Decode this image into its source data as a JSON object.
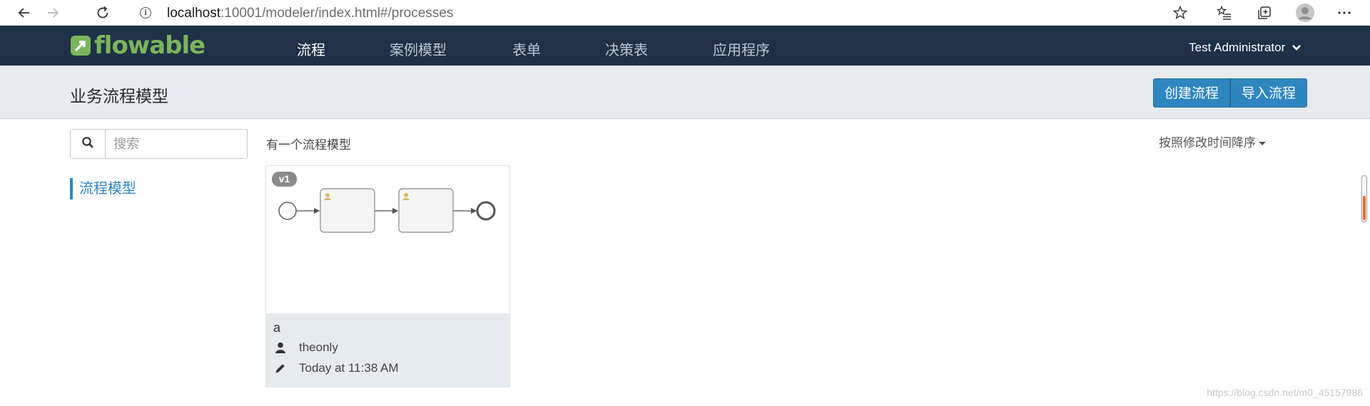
{
  "browser": {
    "url_host": "localhost",
    "url_rest": ":10001/modeler/index.html#/processes",
    "icons": [
      "back-arrow-icon",
      "forward-arrow-icon",
      "refresh-icon",
      "info-icon",
      "favorite-star-icon",
      "favorites-list-icon",
      "collections-icon",
      "profile-icon",
      "more-icon"
    ]
  },
  "navbar": {
    "brand": "flowable",
    "items": [
      {
        "label": "流程",
        "active": true
      },
      {
        "label": "案例模型",
        "active": false
      },
      {
        "label": "表单",
        "active": false
      },
      {
        "label": "决策表",
        "active": false
      },
      {
        "label": "应用程序",
        "active": false
      }
    ],
    "user": "Test Administrator"
  },
  "subheader": {
    "title": "业务流程模型",
    "create_label": "创建流程",
    "import_label": "导入流程"
  },
  "sidebar": {
    "search_placeholder": "搜索",
    "link_label": "流程模型"
  },
  "main": {
    "count_text": "有一个流程模型",
    "sort_label": "按照修改时间降序"
  },
  "card": {
    "version": "v1",
    "name": "a",
    "owner": "theonly",
    "modified": "Today at 11:38 AM"
  },
  "watermark": "https://blog.csdn.net/m0_45157986",
  "colors": {
    "navbar_bg": "#1f3146",
    "brand_green": "#7ab55c",
    "accent_blue": "#2e86c1",
    "subheader_bg": "#e7ebef",
    "card_info_bg": "#e6ebef"
  }
}
